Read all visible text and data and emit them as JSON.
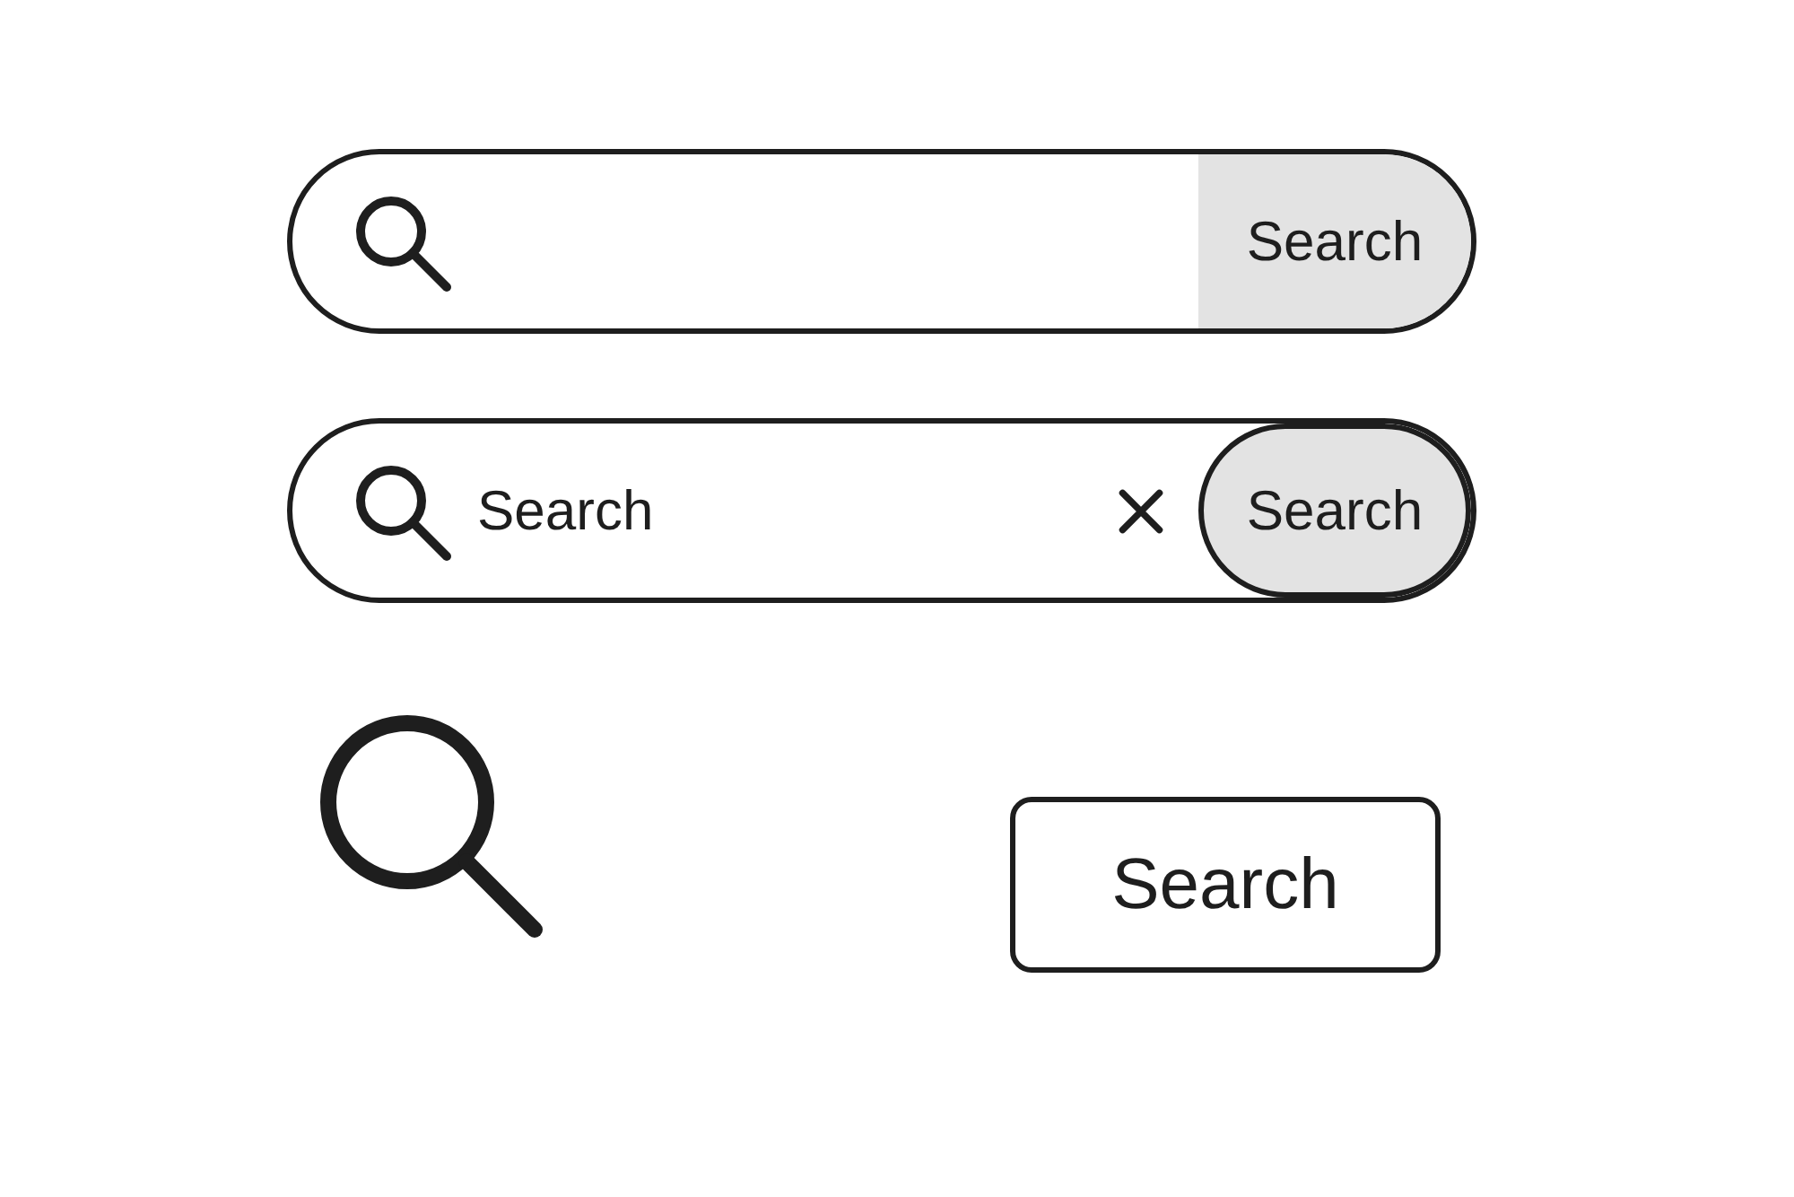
{
  "search_bars": [
    {
      "kind": "flush",
      "button": "Search"
    },
    {
      "kind": "outlined",
      "value": "Search",
      "button": "Search"
    }
  ],
  "standalone_button": "Search"
}
